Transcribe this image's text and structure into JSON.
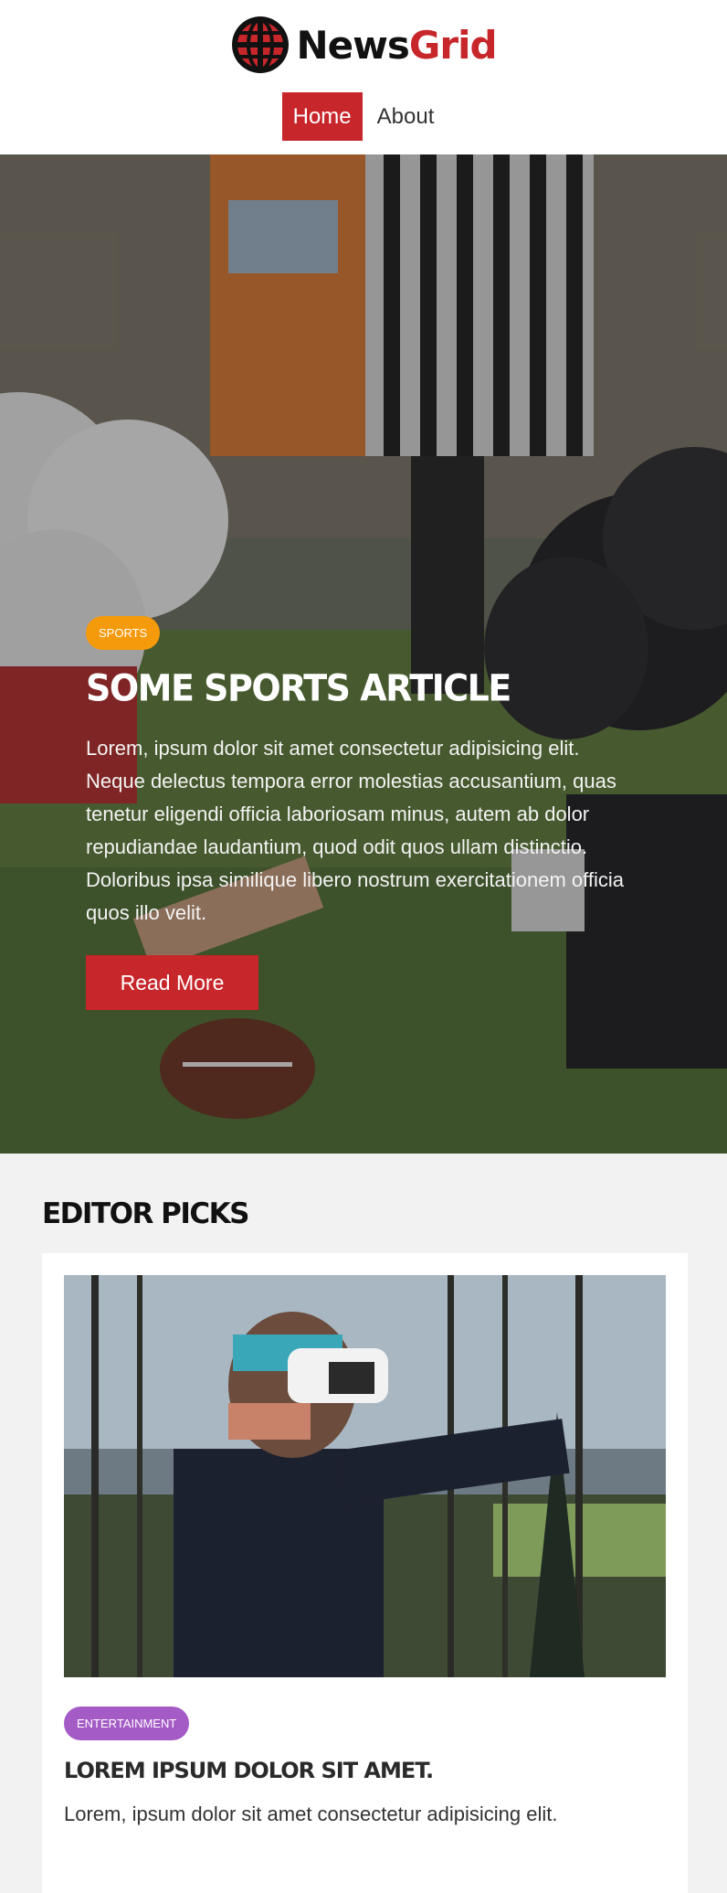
{
  "header": {
    "logo": {
      "word1": "News",
      "word2": "Grid",
      "icon": "globe-icon"
    },
    "nav": [
      {
        "label": "Home",
        "active": true
      },
      {
        "label": "About",
        "active": false
      }
    ]
  },
  "hero": {
    "background": "football-line-of-scrimmage-photo",
    "category": "Sports",
    "title": "Some Sports Article",
    "text": "Lorem, ipsum dolor sit amet consectetur adipisicing elit. Neque delectus tempora error molestias accusantium, quas tenetur eligendi officia laboriosam minus, autem ab dolor repudiandae laudantium, quod odit quos ullam distinctio. Doloribus ipsa similique libero nostrum exercitationem officia quos illo velit.",
    "button_label": "Read More"
  },
  "editor_picks": {
    "heading": "Editor Picks",
    "cards": [
      {
        "image": "vr-headset-forest-photo",
        "category": "Entertainment",
        "title": "Lorem ipsum dolor sit amet.",
        "text": "Lorem, ipsum dolor sit amet consectetur adipisicing elit."
      }
    ]
  },
  "colors": {
    "brand": "#c7262b",
    "sports": "#f59a0b",
    "entertainment": "#a45bc6",
    "page_bg": "#f2f2f2"
  }
}
